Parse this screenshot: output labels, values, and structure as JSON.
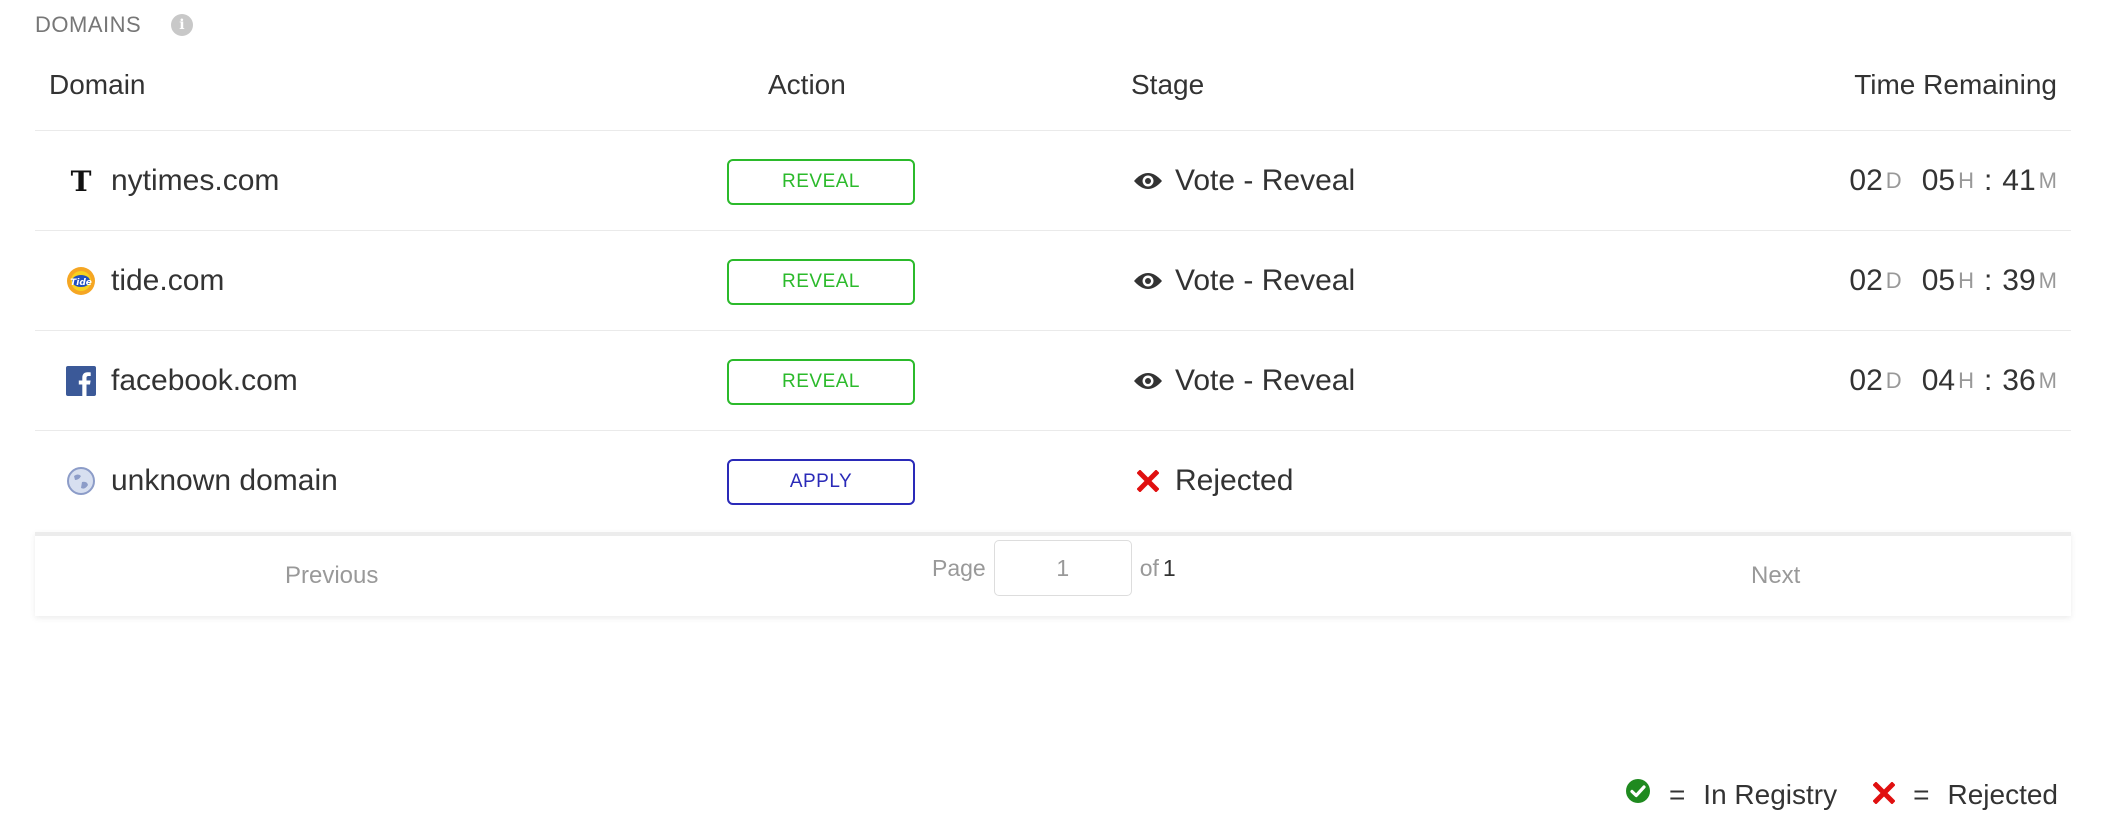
{
  "section": {
    "title": "DOMAINS",
    "info_icon": "info-icon"
  },
  "table": {
    "headers": {
      "domain": "Domain",
      "action": "Action",
      "stage": "Stage",
      "time": "Time Remaining"
    },
    "rows": [
      {
        "domain": "nytimes.com",
        "icon": "nytimes-logo-icon",
        "action": "REVEAL",
        "stage": "Vote - Reveal",
        "stage_icon": "eye-icon",
        "time": {
          "d": "02",
          "d_unit": "D",
          "h": "05",
          "h_unit": "H",
          "sep": ":",
          "m": "41",
          "m_unit": "M"
        }
      },
      {
        "domain": "tide.com",
        "icon": "tide-logo-icon",
        "action": "REVEAL",
        "stage": "Vote - Reveal",
        "stage_icon": "eye-icon",
        "time": {
          "d": "02",
          "d_unit": "D",
          "h": "05",
          "h_unit": "H",
          "sep": ":",
          "m": "39",
          "m_unit": "M"
        }
      },
      {
        "domain": "facebook.com",
        "icon": "facebook-logo-icon",
        "action": "REVEAL",
        "stage": "Vote - Reveal",
        "stage_icon": "eye-icon",
        "time": {
          "d": "02",
          "d_unit": "D",
          "h": "04",
          "h_unit": "H",
          "sep": ":",
          "m": "36",
          "m_unit": "M"
        }
      },
      {
        "domain": "unknown domain",
        "icon": "globe-icon",
        "action": "APPLY",
        "stage": "Rejected",
        "stage_icon": "cross-icon"
      }
    ]
  },
  "pagination": {
    "previous": "Previous",
    "page_label": "Page",
    "current_page": "1",
    "of_label": "of",
    "total_pages": "1",
    "next": "Next"
  },
  "legend": {
    "in_registry_icon": "check-circle-icon",
    "eq": "=",
    "in_registry": "In Registry",
    "rejected_icon": "cross-icon",
    "rejected": "Rejected"
  },
  "colors": {
    "reveal": "#2bba2b",
    "apply": "#2a2ab8",
    "rejected": "#e01010",
    "in_registry": "#1f8a1f",
    "facebook": "#3b5998"
  }
}
